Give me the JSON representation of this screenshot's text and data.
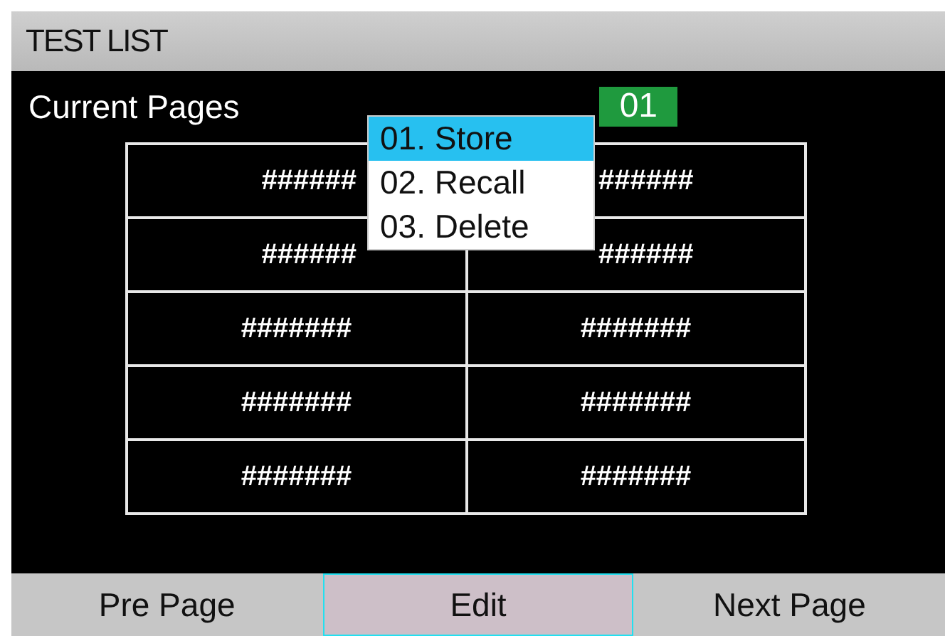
{
  "window": {
    "title": "TEST LIST"
  },
  "current_pages": {
    "label": "Current Pages",
    "value": "01"
  },
  "table": {
    "rows": [
      {
        "cells": [
          "######",
          "######"
        ],
        "covered": true
      },
      {
        "cells": [
          "######",
          "######"
        ],
        "covered": true
      },
      {
        "cells": [
          "#######",
          "#######"
        ],
        "covered": false
      },
      {
        "cells": [
          "#######",
          "#######"
        ],
        "covered": false
      },
      {
        "cells": [
          "#######",
          "#######"
        ],
        "covered": false
      }
    ]
  },
  "menu": {
    "items": [
      {
        "label": "01. Store",
        "selected": true
      },
      {
        "label": "02. Recall",
        "selected": false
      },
      {
        "label": "03. Delete",
        "selected": false
      }
    ]
  },
  "softkeys": [
    {
      "label": "Pre Page",
      "selected": false
    },
    {
      "label": "Edit",
      "selected": true
    },
    {
      "label": "Next Page",
      "selected": false
    }
  ]
}
